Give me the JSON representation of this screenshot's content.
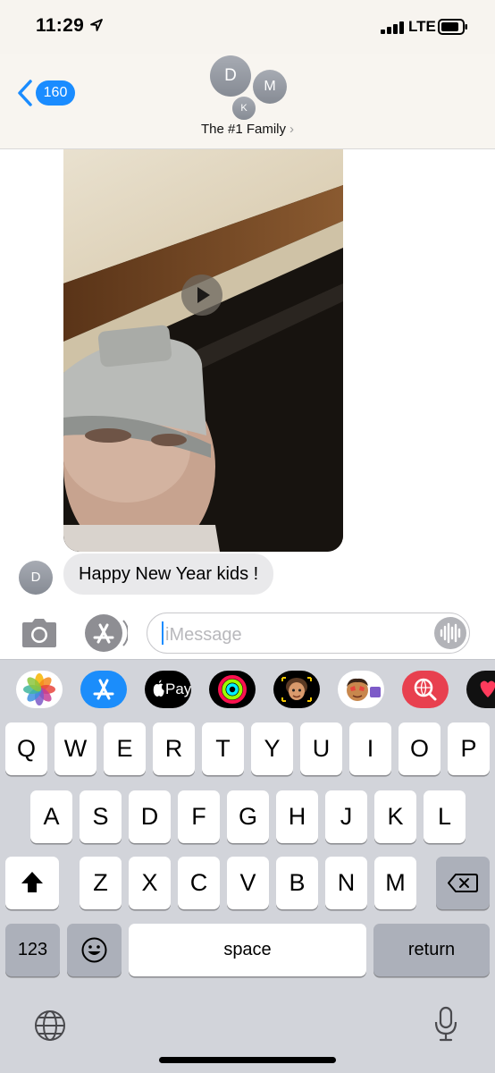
{
  "status_bar": {
    "time": "11:29",
    "network": "LTE"
  },
  "header": {
    "back_count": "160",
    "avatars": [
      "D",
      "M",
      "K"
    ],
    "group_name": "The #1 Family",
    "group_chevron": "›"
  },
  "conversation": {
    "video": {
      "icon": "play-icon"
    },
    "message": {
      "sender_initial": "D",
      "text": "Happy New Year kids !"
    }
  },
  "input_bar": {
    "placeholder": "iMessage",
    "value": ""
  },
  "app_drawer": {
    "apps": [
      "photos-icon",
      "app-store-icon",
      "apple-pay-icon",
      "activity-icon",
      "memoji-icon",
      "animoji-icon",
      "web-search-icon",
      "digital-touch-icon"
    ],
    "apple_pay_label": "Pay"
  },
  "keyboard": {
    "row1": [
      "Q",
      "W",
      "E",
      "R",
      "T",
      "Y",
      "U",
      "I",
      "O",
      "P"
    ],
    "row2": [
      "A",
      "S",
      "D",
      "F",
      "G",
      "H",
      "J",
      "K",
      "L"
    ],
    "row3": [
      "Z",
      "X",
      "C",
      "V",
      "B",
      "N",
      "M"
    ],
    "numbers_label": "123",
    "space_label": "space",
    "return_label": "return"
  },
  "colors": {
    "accent": "#1a8cff",
    "bubble_received": "#e9e9eb",
    "keyboard_bg": "#d2d4da"
  }
}
